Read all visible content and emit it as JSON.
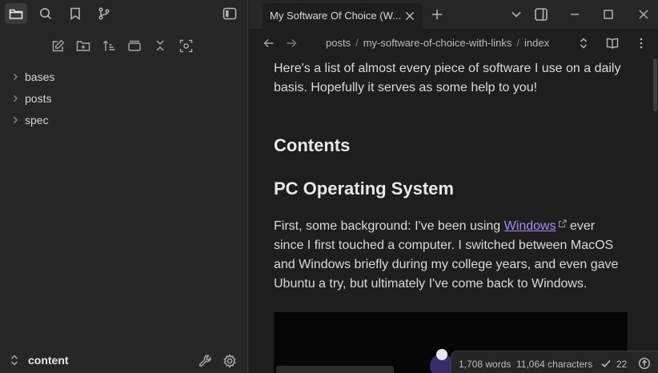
{
  "sidebar": {
    "ribbon_icons": [
      "folder-icon",
      "search-icon",
      "bookmark-icon",
      "git-branch-icon",
      "sidebar-toggle-icon"
    ],
    "nav_actions": [
      "new-note-icon",
      "new-folder-icon",
      "sort-icon",
      "collapse-view-icon",
      "collapse-all-icon",
      "reveal-file-icon"
    ],
    "tree": [
      {
        "label": "bases"
      },
      {
        "label": "posts"
      },
      {
        "label": "spec"
      }
    ],
    "vault_name": "content",
    "vault_icons": [
      "wrench-icon",
      "gear-icon"
    ]
  },
  "tabs": {
    "active_title": "My Software Of Choice (W...",
    "icons": [
      "close-icon",
      "plus-icon",
      "chevron-down-icon",
      "split-view-icon",
      "minimize-icon",
      "maximize-icon",
      "close-window-icon"
    ]
  },
  "view": {
    "breadcrumb": [
      "posts",
      "my-software-of-choice-with-links",
      "index"
    ],
    "icons": [
      "back-arrow-icon",
      "forward-arrow-icon",
      "expand-icon",
      "reading-view-icon",
      "more-options-icon"
    ]
  },
  "document": {
    "intro_line1": "Here's a list of almost every piece of software I use on a daily",
    "intro_line2": "basis. Hopefully it serves as some help to you!",
    "heading_contents": "Contents",
    "heading_pc_os": "PC Operating System",
    "p2_prefix": "First, some background: I've been using ",
    "p2_link": "Windows",
    "p2_line1_suffix": " ever",
    "p2_line2": "since I first touched a computer. I switched between MacOS",
    "p2_line3": "and Windows briefly during my college years, and even gave",
    "p2_line4": "Ubuntu a try, but ultimately I've come back to Windows."
  },
  "status": {
    "words": "1,708 words",
    "characters": "11,064 characters",
    "count": "22"
  },
  "colors": {
    "background": "#1e1e1e",
    "sidebar": "#262626",
    "link": "#a88bfa"
  }
}
